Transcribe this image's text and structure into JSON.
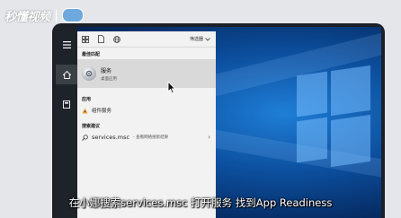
{
  "watermark": {
    "brand": "秒懂视频"
  },
  "start_panel": {
    "filter_label": "筛选器",
    "best_match": {
      "heading": "最佳匹配",
      "title": "服务",
      "subtitle": "桌面应用"
    },
    "apps": {
      "heading": "应用",
      "items": [
        {
          "label": "组件服务"
        }
      ]
    },
    "web": {
      "heading": "搜索建议",
      "query": "services.msc",
      "hint": "- 查看网络搜索结果"
    }
  },
  "subtitle": "在小娜搜索services.msc 打开服务 找到App Readiness",
  "colors": {
    "desktop": "#0c4f9e",
    "panel": "#f2f2f2",
    "highlight": "#d9d9d9",
    "taskbar": "#1e2229"
  }
}
